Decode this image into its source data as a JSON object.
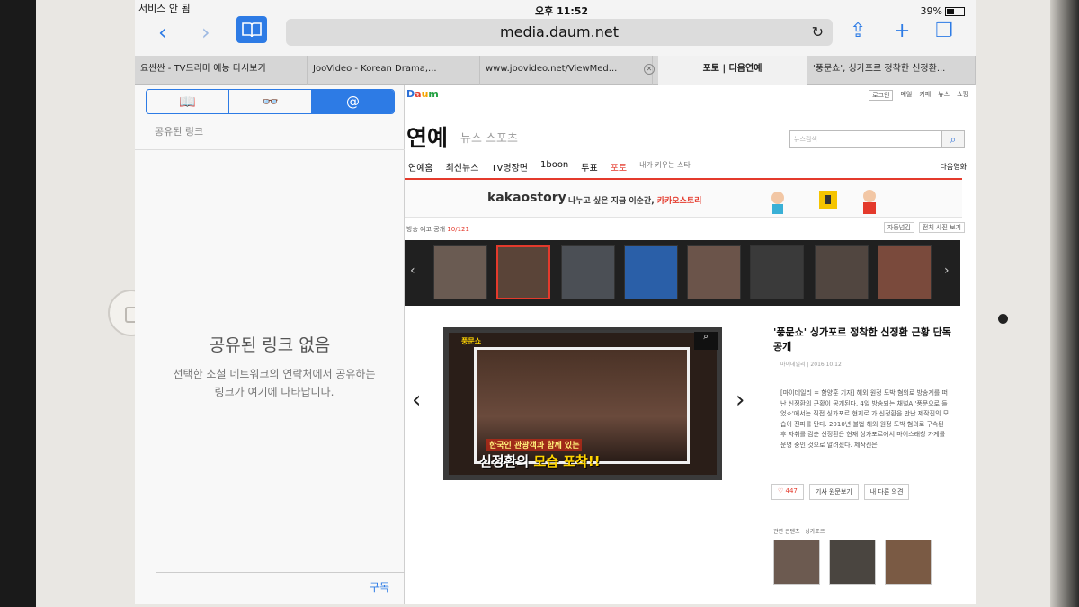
{
  "status": {
    "carrier": "서비스 안 됨",
    "time": "오후 11:52",
    "battery": "39%"
  },
  "nav": {
    "back": "‹",
    "forward": "›",
    "url": "media.daum.net",
    "reload": "↻",
    "share": "⇪",
    "add": "+",
    "tabs": "❐"
  },
  "tabs": [
    {
      "label": "요싼싼 - TV드라마 예능 다시보기"
    },
    {
      "label": "JooVideo - Korean Drama,..."
    },
    {
      "label": "www.joovideo.net/ViewMed..."
    },
    {
      "label": "포토 | 다음연예"
    },
    {
      "label": "'풍문쇼', 싱가포르 정착한 신정환..."
    }
  ],
  "sidebar": {
    "segments": [
      "📖",
      "👓",
      "@"
    ],
    "section_label": "공유된 링크",
    "empty_title": "공유된 링크 없음",
    "empty_desc": "선택한 소셜 네트워크의 연락처에서 공유하는 링크가 여기에 나타납니다.",
    "subscribe": "구독"
  },
  "page": {
    "logo": [
      "D",
      "a",
      "u",
      "m"
    ],
    "util_links": [
      "로그인",
      "메일",
      "카페",
      "뉴스",
      "쇼핑"
    ],
    "section_title": "연예",
    "section_sub": "뉴스  스포츠",
    "search_placeholder": "뉴스검색",
    "menu": [
      "연예홈",
      "최신뉴스",
      "TV명장면",
      "1boon",
      "투표",
      "포토",
      "내가 키우는 스타"
    ],
    "menu_right": "다음영화",
    "banner_brand": "kakaostory",
    "banner_msg": "나누고 싶은 지금 이순간,",
    "banner_msg_em": "카카오스토리",
    "strip_title": "방송 예고 공개",
    "strip_count": "10/121",
    "strip_controls": [
      "자동넘김",
      "전체 사진 보기"
    ],
    "feature_tag": "풍문쇼",
    "feature_cap1": "한국인 관광객과 함께 있는",
    "feature_cap2_a": "신정환의 ",
    "feature_cap2_b": "모습 포착!!",
    "article_title": "'풍문쇼' 싱가포르 정착한 신정환 근황 단독 공개",
    "article_meta": "마이데일리 | 2016.10.12",
    "article_body": "[마이데일리 = 함양훈 기자] 해외 원정 도박 혐의로 방송계를 떠난 신정환의 근황이 공개된다. 4일 방송되는 채널A '풍문으로 들었쇼'에서는 직접 싱가포르 현지로 가 신정환을 만난 제작진의 모습이 전파를 탄다. 2010년 불법 해외 원정 도박 혐의로 구속된 후 자취를 감춘 신정환은 현재 싱가포르에서 마이스래칭 가게를 운영 중인 것으로 알려졌다. 제작진은",
    "likes": "♡ 447",
    "action_2": "기사 원문보기",
    "action_3": "내 다른 의견",
    "related_head": "관련 콘텐츠 · 싱가포르"
  }
}
